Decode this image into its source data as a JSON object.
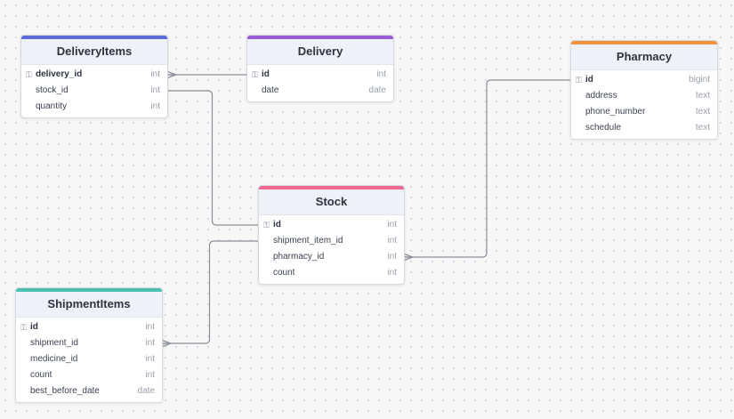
{
  "colors": {
    "DeliveryItems": "#5c6bd6",
    "Delivery": "#9a5bd8",
    "Pharmacy": "#f0933f",
    "Stock": "#ef6a93",
    "ShipmentItems": "#48c1b1"
  },
  "icons": {
    "primary_key": "key-icon"
  },
  "tables": [
    {
      "name": "DeliveryItems",
      "columns": [
        {
          "name": "delivery_id",
          "type": "int",
          "pk": true
        },
        {
          "name": "stock_id",
          "type": "int",
          "pk": false
        },
        {
          "name": "quantity",
          "type": "int",
          "pk": false
        }
      ]
    },
    {
      "name": "Delivery",
      "columns": [
        {
          "name": "id",
          "type": "int",
          "pk": true
        },
        {
          "name": "date",
          "type": "date",
          "pk": false
        }
      ]
    },
    {
      "name": "Pharmacy",
      "columns": [
        {
          "name": "id",
          "type": "bigint",
          "pk": true
        },
        {
          "name": "address",
          "type": "text",
          "pk": false
        },
        {
          "name": "phone_number",
          "type": "text",
          "pk": false
        },
        {
          "name": "schedule",
          "type": "text",
          "pk": false
        }
      ]
    },
    {
      "name": "Stock",
      "columns": [
        {
          "name": "id",
          "type": "int",
          "pk": true
        },
        {
          "name": "shipment_item_id",
          "type": "int",
          "pk": false
        },
        {
          "name": "pharmacy_id",
          "type": "int",
          "pk": false
        },
        {
          "name": "count",
          "type": "int",
          "pk": false
        }
      ]
    },
    {
      "name": "ShipmentItems",
      "columns": [
        {
          "name": "id",
          "type": "int",
          "pk": true
        },
        {
          "name": "shipment_id",
          "type": "int",
          "pk": false
        },
        {
          "name": "medicine_id",
          "type": "int",
          "pk": false
        },
        {
          "name": "count",
          "type": "int",
          "pk": false
        },
        {
          "name": "best_before_date",
          "type": "date",
          "pk": false
        }
      ]
    }
  ],
  "relationships": [
    {
      "from_table": "DeliveryItems",
      "from_column": "delivery_id",
      "to_table": "Delivery",
      "to_column": "id",
      "cardinality": "many-to-one"
    },
    {
      "from_table": "DeliveryItems",
      "from_column": "stock_id",
      "to_table": "Stock",
      "to_column": "id",
      "cardinality": "many-to-one"
    },
    {
      "from_table": "ShipmentItems",
      "from_column": "id",
      "to_table": "Stock",
      "to_column": "shipment_item_id",
      "cardinality": "one-to-many"
    },
    {
      "from_table": "Pharmacy",
      "from_column": "id",
      "to_table": "Stock",
      "to_column": "pharmacy_id",
      "cardinality": "one-to-many"
    }
  ]
}
